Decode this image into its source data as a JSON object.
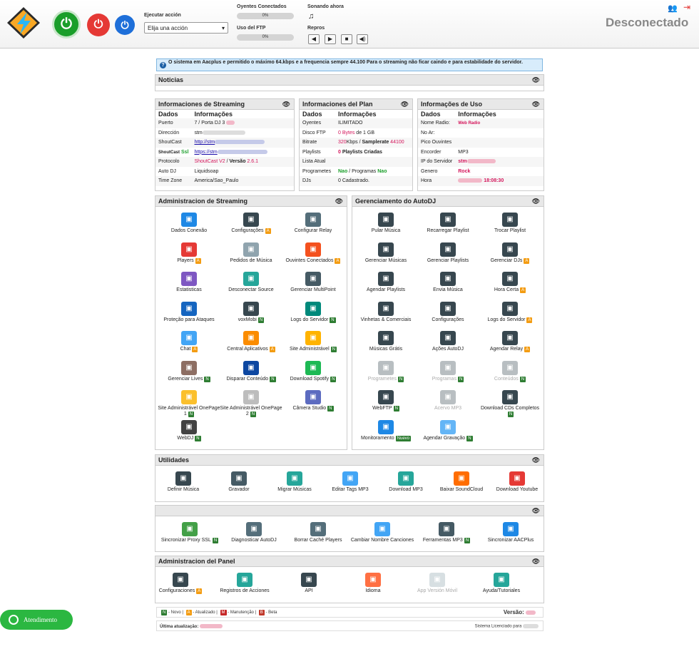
{
  "header": {
    "action_label": "Ejecutar acción",
    "action_select": "Elija una acción",
    "listeners_label": "Oyentes Conectados",
    "listeners_pct": "0%",
    "listeners_fill": 0,
    "ftp_label": "Uso del FTP",
    "ftp_pct": "0%",
    "ftp_fill": 0,
    "playing_label": "Sonando ahora",
    "repros_label": "Repros",
    "status": "Desconectado",
    "colors": {
      "power_on": "#1a9e2a",
      "power_off": "#e53935",
      "power_restart": "#1e6fd9"
    }
  },
  "notice": "O sistema em Aacplus e permitido o máximo 64.kbps e a frequencia sempre 44.100 Para o streaming não ficar caindo e para estabilidade do servidor.",
  "news": {
    "title": "Noticias"
  },
  "streaming_info": {
    "title": "Informaciones de Streaming",
    "col1": "Dados",
    "col2": "Informações",
    "rows": [
      {
        "k": "Puerto",
        "v": "7 / Porta DJ 3"
      },
      {
        "k": "Dirección",
        "v": "stm"
      },
      {
        "k": "ShoutCast",
        "v": "http://stm"
      },
      {
        "k": "ShoutCast",
        "k2": "Ssl",
        "v": "https://stm"
      },
      {
        "k": "Protocolo",
        "v1": "ShoutCast V2",
        "v2": " / ",
        "v3": "Versão",
        "v4": " 2.6.1"
      },
      {
        "k": "Auto DJ",
        "v": "Liquidsoap"
      },
      {
        "k": "Time Zone",
        "v": "America/Sao_Paulo"
      }
    ]
  },
  "plan_info": {
    "title": "Informaciones del Plan",
    "col1": "Dados",
    "col2": "Informações",
    "rows": [
      {
        "k": "Oyentes",
        "v": "ILIMITADO"
      },
      {
        "k": "Disco FTP",
        "v1": "0 Bytes",
        "v2": " de ",
        "v3": "1 GB"
      },
      {
        "k": "Bitrate",
        "v1": "320",
        "v2": "Kbps / ",
        "v3": "Samplerate",
        "v4": " 44100"
      },
      {
        "k": "Playlists",
        "v1": "0",
        "v2": " Playlists Criadas"
      },
      {
        "k": "Lista Atual",
        "v": ""
      },
      {
        "k": "Programetes",
        "v1": "Nao",
        "v2": " / Programas ",
        "v3": "Nao"
      },
      {
        "k": "DJs",
        "v": "0 Cadastrado."
      }
    ]
  },
  "usage_info": {
    "title": "Informações de Uso",
    "col1": "Dados",
    "col2": "Informações",
    "rows": [
      {
        "k": "Nome Radio:",
        "v": "Web Radio"
      },
      {
        "k": "No Ar:",
        "v": ""
      },
      {
        "k": "Pico Ouvintes",
        "v": ""
      },
      {
        "k": "Encorder",
        "v": "MP3"
      },
      {
        "k": "IP do Servidor",
        "v": "stm"
      },
      {
        "k": "Genero",
        "v": "Rock"
      },
      {
        "k": "Hora",
        "v": "18:08:30"
      }
    ]
  },
  "admin_streaming": {
    "title": "Administracion de Streaming",
    "tiles": [
      {
        "label": "Dados Conexão",
        "icon": "network-icon",
        "color": "#1e88e5"
      },
      {
        "label": "Configurações",
        "badge": "A",
        "icon": "monitor-gear-icon",
        "color": "#37474f"
      },
      {
        "label": "Configurar Relay",
        "icon": "relay-monitor-icon",
        "color": "#546e7a"
      },
      {
        "label": "Players",
        "badge": "A",
        "icon": "hand-touch-icon",
        "color": "#e53935"
      },
      {
        "label": "Pedidos de Música",
        "icon": "music-doc-icon",
        "color": "#90a4ae"
      },
      {
        "label": "Ouvintes Conectados",
        "badge": "A",
        "icon": "headset-user-icon",
        "color": "#f4511e"
      },
      {
        "label": "Estatisticas",
        "icon": "chart-icon",
        "color": "#7e57c2"
      },
      {
        "label": "Desconectar Source",
        "icon": "cloud-x-icon",
        "color": "#26a69a"
      },
      {
        "label": "Gerenciar MultiPoint",
        "icon": "multipoint-icon",
        "color": "#455a64"
      },
      {
        "label": "Proteção para Ataques",
        "icon": "shield-server-icon",
        "color": "#1565c0"
      },
      {
        "label": "voxMobi",
        "badge": "N",
        "icon": "vox-monitor-icon",
        "color": "#37474f"
      },
      {
        "label": "Logs do Servidor",
        "badge": "N",
        "icon": "log-search-icon",
        "color": "#00897b"
      },
      {
        "label": "Chat",
        "badge": "A",
        "icon": "chat-icon",
        "color": "#42a5f5"
      },
      {
        "label": "Central Aplicativos",
        "badge": "A",
        "icon": "phone-apps-icon",
        "color": "#fb8c00"
      },
      {
        "label": "Site Administrável",
        "badge": "N",
        "icon": "site-icon",
        "color": "#ffb300"
      },
      {
        "label": "Gerenciar Lives",
        "badge": "N",
        "icon": "users-icon",
        "color": "#8d6e63"
      },
      {
        "label": "Disparar Conteúdo",
        "badge": "N",
        "icon": "music-circle-icon",
        "color": "#0d47a1"
      },
      {
        "label": "Download Spotify",
        "badge": "N",
        "icon": "spotify-icon",
        "color": "#1db954"
      },
      {
        "label": "Site Administrável OnePage 1",
        "badge": "N",
        "icon": "onepage-icon",
        "color": "#fbc02d"
      },
      {
        "label": "Site Administrável OnePage 2",
        "badge": "N",
        "icon": "onepage2-icon",
        "color": "#bdbdbd"
      },
      {
        "label": "Câmera Studio",
        "badge": "N",
        "icon": "camera-icon",
        "color": "#5c6bc0"
      },
      {
        "label": "WebDJ",
        "badge": "N",
        "icon": "mixer-icon",
        "color": "#424242"
      }
    ]
  },
  "autodj": {
    "title": "Gerenciamento do AutoDJ",
    "tiles": [
      {
        "label": "Pular Música",
        "icon": "skip-icon",
        "color": "#37474f"
      },
      {
        "label": "Recarregar Playlist",
        "icon": "reload-icon",
        "color": "#37474f"
      },
      {
        "label": "Trocar Playlist",
        "icon": "shuffle-icon",
        "color": "#37474f"
      },
      {
        "label": "Gerenciar Músicas",
        "icon": "music-list-icon",
        "color": "#37474f"
      },
      {
        "label": "Gerenciar Playlists",
        "icon": "playlist-icon",
        "color": "#37474f"
      },
      {
        "label": "Gerenciar DJs",
        "badge": "A",
        "icon": "dj-icon",
        "color": "#37474f"
      },
      {
        "label": "Agendar Playlists",
        "icon": "calendar-icon",
        "color": "#37474f"
      },
      {
        "label": "Envia Música",
        "icon": "cloud-upload-icon",
        "color": "#37474f"
      },
      {
        "label": "Hora Certa",
        "badge": "A",
        "icon": "clock-icon",
        "color": "#37474f"
      },
      {
        "label": "Vinhetas & Comerciais",
        "icon": "headphones-icon",
        "color": "#37474f"
      },
      {
        "label": "Configurações",
        "icon": "tools-icon",
        "color": "#37474f"
      },
      {
        "label": "Logs do Servidor",
        "badge": "A",
        "icon": "log-icon",
        "color": "#37474f"
      },
      {
        "label": "Músicas Grátis",
        "icon": "free-music-icon",
        "color": "#37474f"
      },
      {
        "label": "Ações AutoDJ",
        "icon": "actions-icon",
        "color": "#37474f"
      },
      {
        "label": "Agendar Relay",
        "badge": "A",
        "icon": "relay-calendar-icon",
        "color": "#37474f"
      },
      {
        "label": "Programetes",
        "badge": "N",
        "disabled": true,
        "icon": "mic-icon",
        "color": "#37474f"
      },
      {
        "label": "Programas",
        "badge": "N",
        "disabled": true,
        "icon": "mic-doc-icon",
        "color": "#37474f"
      },
      {
        "label": "Conteúdos",
        "badge": "N",
        "disabled": true,
        "icon": "disc-icon",
        "color": "#37474f"
      },
      {
        "label": "WebFTP",
        "badge": "N",
        "icon": "ftp-icon",
        "color": "#37474f"
      },
      {
        "label": "Acervo MP3",
        "disabled": true,
        "icon": "tablet-icon",
        "color": "#37474f"
      },
      {
        "label": "Download CDs Completos",
        "badge": "N",
        "icon": "cd-download-icon",
        "color": "#37474f"
      },
      {
        "label": "Monitoramento",
        "badge": "Nuevo",
        "icon": "monitor-icon",
        "color": "#1e88e5"
      },
      {
        "label": "Agendar Gravação",
        "badge": "N",
        "icon": "rec-schedule-icon",
        "color": "#64b5f6"
      }
    ]
  },
  "utilities": {
    "title": "Utilidades",
    "tiles": [
      {
        "label": "Definir Música",
        "icon": "music-screen-icon",
        "color": "#37474f"
      },
      {
        "label": "Gravador",
        "icon": "recorder-icon",
        "color": "#455a64"
      },
      {
        "label": "Migrar Músicas",
        "icon": "migrate-icon",
        "color": "#26a69a"
      },
      {
        "label": "Editar Tags MP3",
        "icon": "tag-edit-icon",
        "color": "#42a5f5"
      },
      {
        "label": "Download MP3",
        "icon": "mp3-download-icon",
        "color": "#26a69a"
      },
      {
        "label": "Baixar SoundCloud",
        "icon": "soundcloud-icon",
        "color": "#ff6d00"
      },
      {
        "label": "Download Youtube",
        "icon": "youtube-icon",
        "color": "#e53935"
      }
    ]
  },
  "tools": {
    "title": "",
    "tiles": [
      {
        "label": "Sincronizar Proxy SSL",
        "badge": "N",
        "icon": "ssl-icon",
        "color": "#43a047"
      },
      {
        "label": "Diagnosticar AutoDJ",
        "icon": "stethoscope-icon",
        "color": "#546e7a"
      },
      {
        "label": "Borrar Caché Players",
        "icon": "trash-icon",
        "color": "#546e7a"
      },
      {
        "label": "Cambiar Nombre Canciones",
        "icon": "rename-icon",
        "color": "#42a5f5"
      },
      {
        "label": "Ferramentas MP3",
        "badge": "N",
        "icon": "equalizer-icon",
        "color": "#455a64"
      },
      {
        "label": "Sincronizar AACPlus",
        "icon": "sync-icon",
        "color": "#1e88e5"
      }
    ]
  },
  "panel_admin": {
    "title": "Administracion del Panel",
    "tiles": [
      {
        "label": "Configuraciones",
        "badge": "A",
        "icon": "settings-icon",
        "color": "#37474f"
      },
      {
        "label": "Registros de Acciones",
        "icon": "records-icon",
        "color": "#26a69a"
      },
      {
        "label": "API",
        "icon": "api-icon",
        "color": "#37474f"
      },
      {
        "label": "Idioma",
        "icon": "language-icon",
        "color": "#ff7043"
      },
      {
        "label": "App Versión Móvil",
        "disabled": true,
        "icon": "mobile-icon",
        "color": "#90a4ae"
      },
      {
        "label": "Ayuda/Tutoriales",
        "icon": "help-icon",
        "color": "#26a69a"
      }
    ]
  },
  "legend": {
    "n": "N",
    "n_text": " - Novo | ",
    "a": "A",
    "a_text": " - Atualizado | ",
    "m": "M",
    "m_text": " - Manutenção | ",
    "b": "B",
    "b_text": " - Beta",
    "version": "Versão:"
  },
  "footer": {
    "updated": "Última atualização:",
    "licensed": "Sistema Licenciado para"
  },
  "whatsapp": {
    "label": "Atendimento"
  }
}
